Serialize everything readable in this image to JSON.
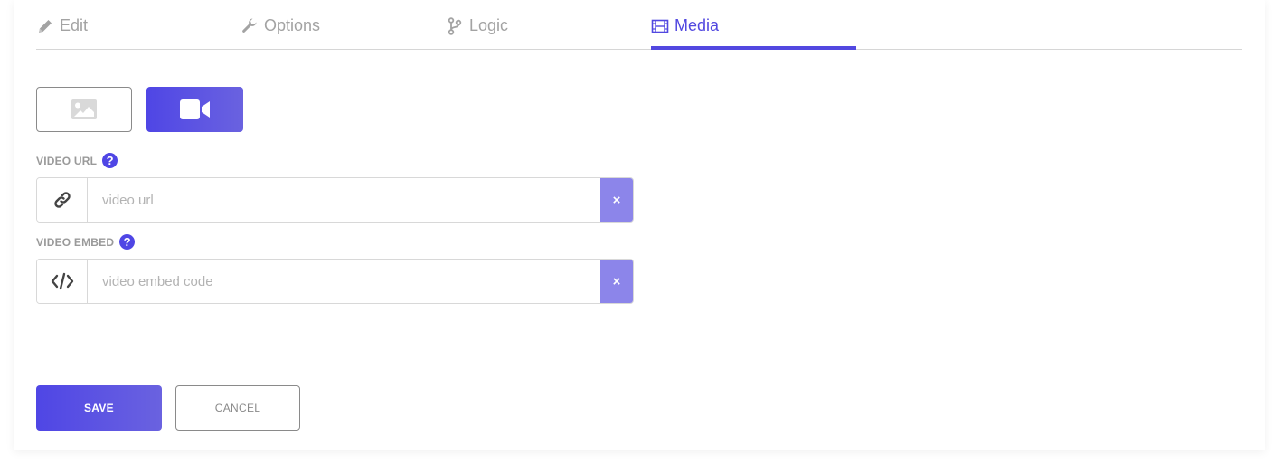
{
  "tabs": [
    {
      "label": "Edit",
      "icon": "pencil-icon",
      "active": false
    },
    {
      "label": "Options",
      "icon": "wrench-icon",
      "active": false
    },
    {
      "label": "Logic",
      "icon": "branch-icon",
      "active": false
    },
    {
      "label": "Media",
      "icon": "film-icon",
      "active": true
    }
  ],
  "media_types": [
    {
      "icon": "image-icon",
      "selected": false
    },
    {
      "icon": "video-camera-icon",
      "selected": true
    }
  ],
  "video_url": {
    "label": "VIDEO URL",
    "help": "?",
    "value": "",
    "placeholder": "video url",
    "clear": "×",
    "icon": "link-icon"
  },
  "video_embed": {
    "label": "VIDEO EMBED",
    "help": "?",
    "value": "",
    "placeholder": "video embed code",
    "clear": "×",
    "icon": "code-icon"
  },
  "actions": {
    "save": "SAVE",
    "cancel": "CANCEL"
  },
  "colors": {
    "accent": "#4f46e5",
    "accent_light": "#8c85ea",
    "muted": "#a3a3a3"
  }
}
